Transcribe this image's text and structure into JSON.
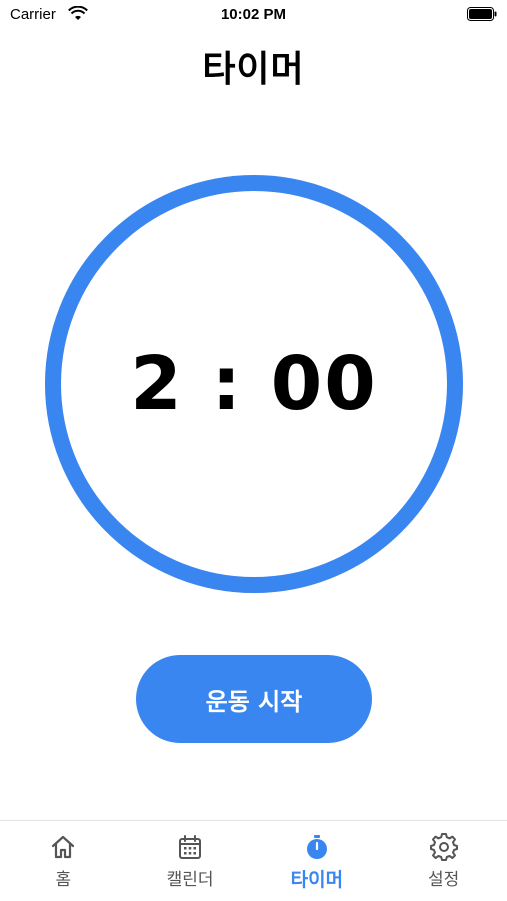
{
  "status_bar": {
    "carrier": "Carrier",
    "time": "10:02 PM",
    "icons": [
      "wifi-icon",
      "battery-icon"
    ]
  },
  "page": {
    "title": "타이머"
  },
  "timer": {
    "display": "2 : 00",
    "ring_progress": 1.0
  },
  "actions": {
    "start_label": "운동 시작"
  },
  "tab_bar": {
    "active_index": 2,
    "items": [
      {
        "label": "홈",
        "icon": "home-icon"
      },
      {
        "label": "캘린더",
        "icon": "calendar-icon"
      },
      {
        "label": "타이머",
        "icon": "stopwatch-icon"
      },
      {
        "label": "설정",
        "icon": "gear-icon"
      }
    ]
  },
  "colors": {
    "accent": "#3a86f0",
    "inactive": "#555555",
    "background": "#ffffff"
  }
}
